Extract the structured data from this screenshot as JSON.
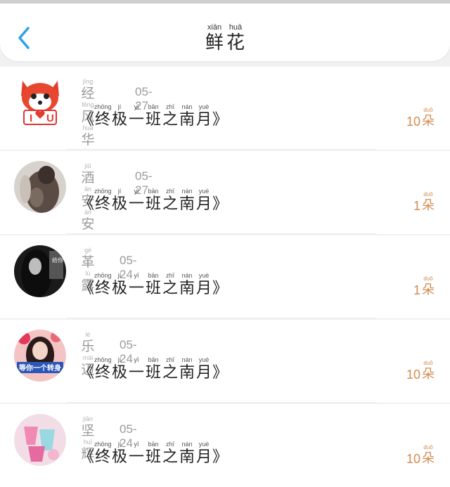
{
  "header": {
    "title": [
      {
        "hz": "鲜",
        "py": "xiān"
      },
      {
        "hz": "花",
        "py": "huā"
      }
    ],
    "back_icon": "chevron-left-icon",
    "accent": "#2aa3e8"
  },
  "book_title": [
    {
      "hz": "终",
      "py": "zhōng"
    },
    {
      "hz": "极",
      "py": "jí"
    },
    {
      "hz": "一",
      "py": "yī"
    },
    {
      "hz": "班",
      "py": "bān"
    },
    {
      "hz": "之",
      "py": "zhī"
    },
    {
      "hz": "南",
      "py": "nán"
    },
    {
      "hz": "月",
      "py": "yuè"
    }
  ],
  "book_open": "《",
  "book_close": "》",
  "unit": {
    "hz": "朵",
    "py": "duǒ"
  },
  "count_color": "#d48a4e",
  "items": [
    {
      "name": [
        {
          "hz": "经",
          "py": "jīng"
        },
        {
          "hz": "风",
          "py": "fēng"
        },
        {
          "hz": "华",
          "py": "huá"
        }
      ],
      "date": "05-27",
      "count": "10"
    },
    {
      "name": [
        {
          "hz": "酒",
          "py": "jiǔ"
        },
        {
          "hz": "安",
          "py": "ān"
        },
        {
          "hz": "安",
          "py": "ān"
        }
      ],
      "date": "05-27",
      "count": "1"
    },
    {
      "name": [
        {
          "hz": "革",
          "py": "gé"
        },
        {
          "hz": "露",
          "py": "lù"
        }
      ],
      "date": "05-24",
      "count": "1"
    },
    {
      "name": [
        {
          "hz": "乐",
          "py": "lè"
        },
        {
          "hz": "迈",
          "py": "mài"
        }
      ],
      "date": "05-24",
      "count": "10"
    },
    {
      "name": [
        {
          "hz": "坚",
          "py": "jiān"
        },
        {
          "hz": "辉",
          "py": "huī"
        }
      ],
      "date": "05-24",
      "count": "10"
    }
  ],
  "avatars": [
    {
      "icon": "fox-cartoon-avatar",
      "text": "I",
      "text2": "U"
    },
    {
      "icon": "blurred-photo-avatar"
    },
    {
      "icon": "dark-hair-portrait-avatar",
      "text": "给你"
    },
    {
      "icon": "girl-portrait-avatar",
      "text": "等你一个转身"
    },
    {
      "icon": "pink-cups-avatar"
    }
  ]
}
